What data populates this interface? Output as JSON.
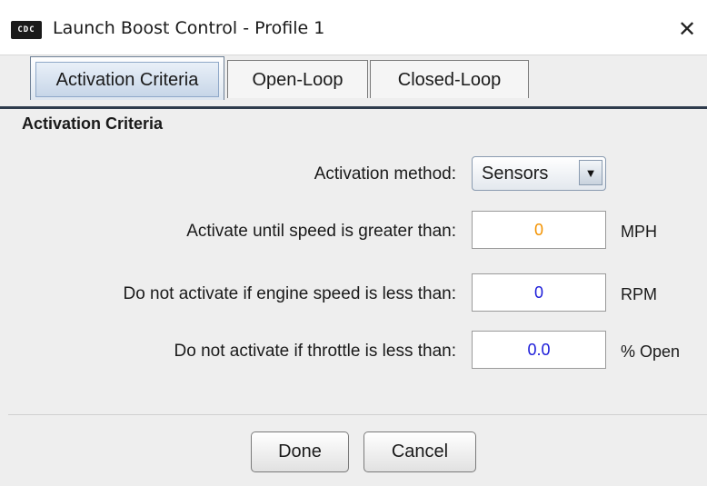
{
  "window": {
    "title": "Launch Boost Control - Profile 1",
    "app_icon_text": "CDC",
    "close_glyph": "✕"
  },
  "tabs": [
    {
      "label": "Activation Criteria",
      "active": true
    },
    {
      "label": "Open-Loop",
      "active": false
    },
    {
      "label": "Closed-Loop",
      "active": false
    }
  ],
  "section": {
    "title": "Activation Criteria"
  },
  "activation_method": {
    "label": "Activation method:",
    "value": "Sensors",
    "arrow_glyph": "▼"
  },
  "fields": [
    {
      "label": "Activate until speed is greater than:",
      "value": "0",
      "unit": "MPH",
      "value_color": "#f39200"
    },
    {
      "label": "Do not activate if engine speed is less than:",
      "value": "0",
      "unit": "RPM",
      "value_color": "#1c1cd9"
    },
    {
      "label": "Do not activate if throttle is less than:",
      "value": "0.0",
      "unit": "% Open",
      "value_color": "#1c1cd9"
    }
  ],
  "buttons": {
    "done": "Done",
    "cancel": "Cancel"
  },
  "colors": {
    "tab_active_border": "#6d7f95",
    "tab_rule": "#2e3b4c"
  }
}
